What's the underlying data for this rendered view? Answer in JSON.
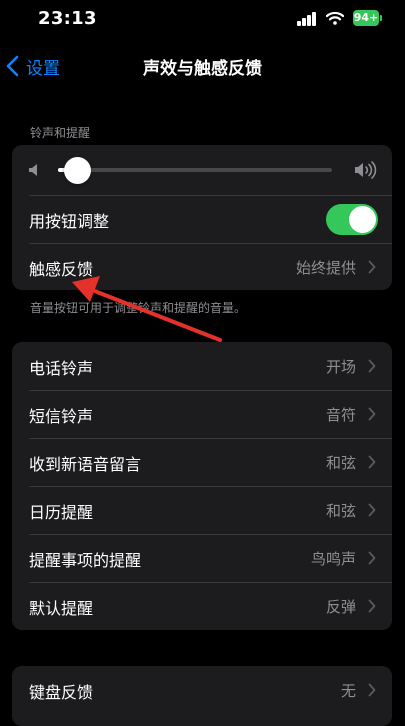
{
  "status_bar": {
    "time": "23:13",
    "battery": "94+"
  },
  "nav": {
    "back_label": "设置",
    "title": "声效与触感反馈"
  },
  "ringer_section": {
    "header": "铃声和提醒",
    "volume_level": 0.07,
    "change_with_buttons_label": "用按钮调整",
    "change_with_buttons_on": true,
    "haptics_label": "触感反馈",
    "haptics_value": "始终提供",
    "footer": "音量按钮可用于调整铃声和提醒的音量。"
  },
  "sounds": [
    {
      "label": "电话铃声",
      "value": "开场"
    },
    {
      "label": "短信铃声",
      "value": "音符"
    },
    {
      "label": "收到新语音留言",
      "value": "和弦"
    },
    {
      "label": "日历提醒",
      "value": "和弦"
    },
    {
      "label": "提醒事项的提醒",
      "value": "鸟鸣声"
    },
    {
      "label": "默认提醒",
      "value": "反弹"
    }
  ],
  "keyboard": {
    "label": "键盘反馈",
    "value": "无"
  },
  "colors": {
    "accent": "#0a84ff",
    "toggle_on": "#34c759",
    "annotation_arrow": "#e5312b"
  }
}
